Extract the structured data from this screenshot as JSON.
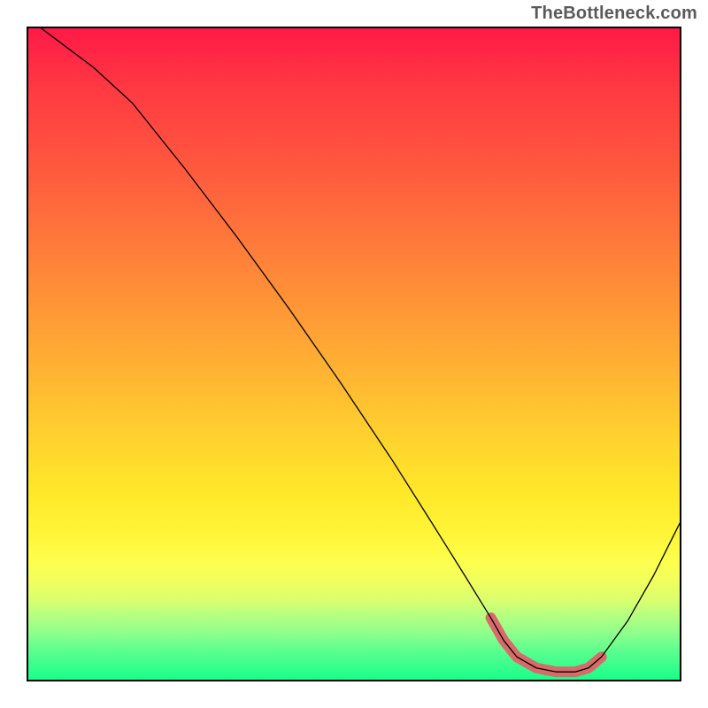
{
  "watermark": "TheBottleneck.com",
  "chart_data": {
    "type": "line",
    "title": "",
    "xlabel": "",
    "ylabel": "",
    "xlim": [
      0,
      100
    ],
    "ylim": [
      0,
      100
    ],
    "grid": false,
    "legend": false,
    "series": [
      {
        "name": "bottleneck-curve",
        "color": "#000000",
        "stroke_width": 1.3,
        "x": [
          2,
          6,
          10,
          16,
          24,
          32,
          40,
          48,
          56,
          62,
          67,
          71,
          73,
          75,
          78,
          81,
          84,
          86,
          88,
          92,
          96,
          100
        ],
        "y": [
          100,
          97,
          94,
          88.5,
          78.5,
          68,
          57,
          45.5,
          33.5,
          24,
          16,
          9.5,
          6,
          3.5,
          1.8,
          1.2,
          1.2,
          1.8,
          3.5,
          9,
          16,
          24
        ]
      },
      {
        "name": "optimal-range-highlight",
        "color": "#d86a6a",
        "stroke_width": 12,
        "x": [
          71,
          73,
          75,
          78,
          81,
          84,
          86,
          88
        ],
        "y": [
          9.5,
          6,
          3.5,
          1.8,
          1.2,
          1.2,
          1.8,
          3.5
        ]
      }
    ],
    "gradient_stops": [
      {
        "pos": 0,
        "color": "#ff1a47"
      },
      {
        "pos": 10,
        "color": "#ff3b42"
      },
      {
        "pos": 22,
        "color": "#ff5a3e"
      },
      {
        "pos": 33,
        "color": "#ff7a3a"
      },
      {
        "pos": 44,
        "color": "#ff9a36"
      },
      {
        "pos": 55,
        "color": "#ffba32"
      },
      {
        "pos": 64,
        "color": "#ffd52e"
      },
      {
        "pos": 72,
        "color": "#ffe92a"
      },
      {
        "pos": 78,
        "color": "#fff63a"
      },
      {
        "pos": 82,
        "color": "#fdff4e"
      },
      {
        "pos": 85,
        "color": "#f0ff5e"
      },
      {
        "pos": 88,
        "color": "#d8ff70"
      },
      {
        "pos": 90,
        "color": "#b8ff80"
      },
      {
        "pos": 93,
        "color": "#8cff8c"
      },
      {
        "pos": 96,
        "color": "#55ff8f"
      },
      {
        "pos": 100,
        "color": "#18ff8a"
      }
    ]
  }
}
